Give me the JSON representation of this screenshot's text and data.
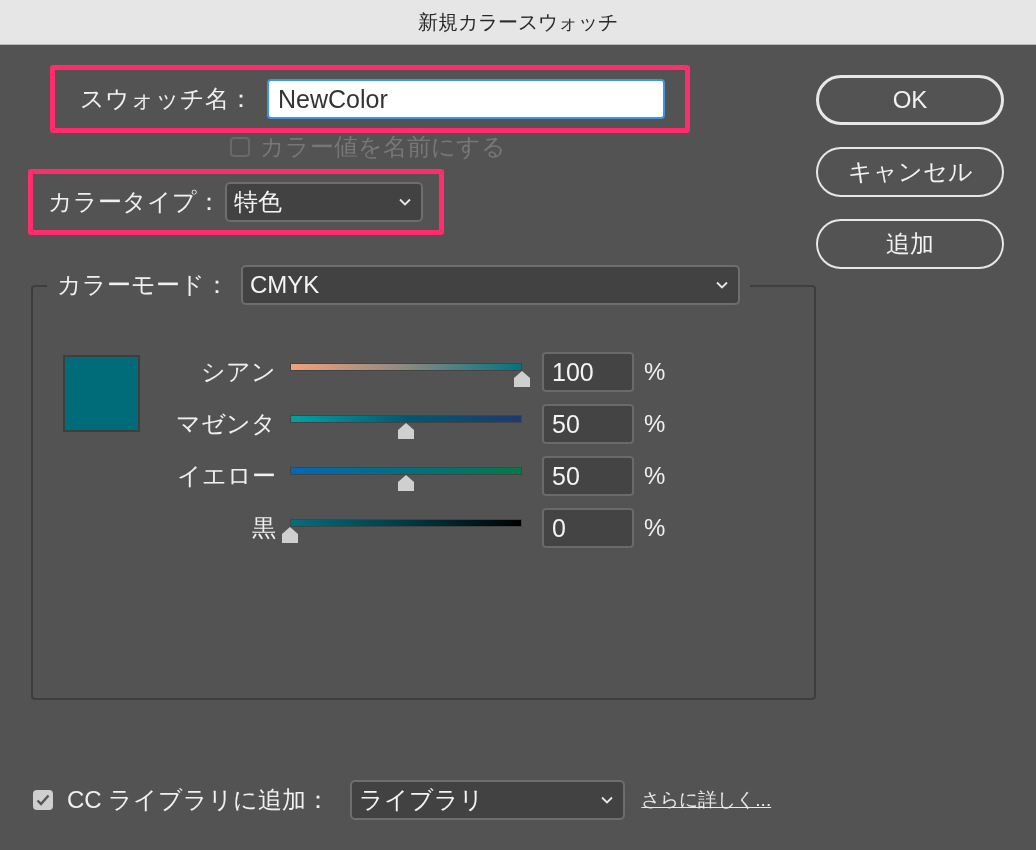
{
  "window": {
    "title": "新規カラースウォッチ"
  },
  "swatch_name": {
    "label": "スウォッチ名：",
    "value": "NewColor",
    "highlighted": true
  },
  "name_from_value": {
    "label": "カラー値を名前にする",
    "checked": false,
    "disabled": true
  },
  "color_type": {
    "label": "カラータイプ：",
    "value": "特色",
    "highlighted": true
  },
  "color_mode": {
    "label": "カラーモード：",
    "value": "CMYK"
  },
  "swatch": {
    "color": "#006b79"
  },
  "channels": [
    {
      "kind": "cyan",
      "name": "シアン",
      "level": 1,
      "value": "100",
      "unit": "%"
    },
    {
      "kind": "magenta",
      "name": "マゼンタ",
      "level": 0.5,
      "value": "50",
      "unit": "%"
    },
    {
      "kind": "yellow",
      "name": "イエロー",
      "level": 0.5,
      "value": "50",
      "unit": "%"
    },
    {
      "kind": "black",
      "name": "黒",
      "level": 0,
      "value": "0",
      "unit": "%"
    }
  ],
  "buttons": [
    {
      "label": "OK",
      "default": true
    },
    {
      "label": "キャンセル",
      "default": false
    },
    {
      "label": "追加",
      "default": false
    }
  ],
  "cc_library": {
    "label": "CC ライブラリに追加：",
    "checked": true,
    "value": "ライブラリ",
    "link": "さらに詳しく..."
  }
}
